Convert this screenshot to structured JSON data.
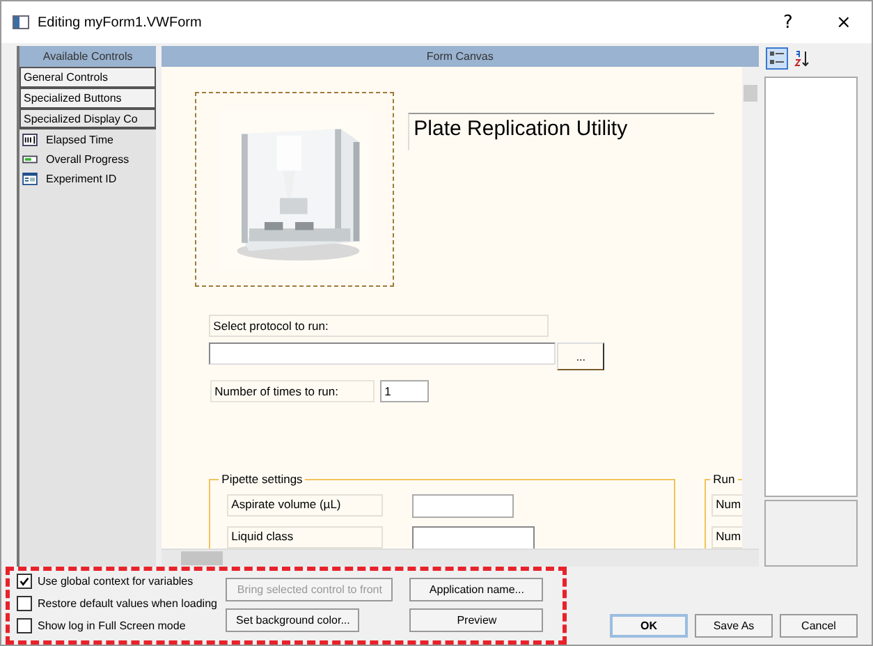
{
  "window": {
    "title": "Editing myForm1.VWForm",
    "help_button": "?",
    "close_button": "×"
  },
  "controls_panel": {
    "header": "Available Controls",
    "groups": [
      {
        "label": "General Controls",
        "expanded": false
      },
      {
        "label": "Specialized Buttons",
        "expanded": false
      },
      {
        "label": "Specialized Display Co",
        "expanded": true,
        "items": [
          {
            "label": "Elapsed Time",
            "kind": "textbox"
          },
          {
            "label": "Overall Progress",
            "kind": "progress"
          },
          {
            "label": "Experiment ID",
            "kind": "form"
          }
        ]
      }
    ]
  },
  "canvas": {
    "header": "Form Canvas",
    "title": "Plate Replication Utility",
    "protocol_label": "Select protocol to run:",
    "browse_button": "...",
    "runs_label": "Number of times to run:",
    "runs_value": "1",
    "pipette_group": {
      "legend": "Pipette settings",
      "fields": [
        {
          "label": "Aspirate volume (µL)",
          "kind": "text"
        },
        {
          "label": "Liquid class",
          "kind": "dropdown"
        }
      ]
    },
    "run_group": {
      "legend": "Run",
      "fields": [
        "Num",
        "Num"
      ]
    }
  },
  "properties_panel": {
    "views": [
      {
        "kind": "categorized",
        "selected": true
      },
      {
        "kind": "alphabetical",
        "selected": false
      }
    ]
  },
  "options": [
    {
      "label": "Use global context for variables",
      "checked": true
    },
    {
      "label": "Restore default values when loading",
      "checked": false
    },
    {
      "label": "Show log in Full Screen mode",
      "checked": false
    }
  ],
  "form_buttons": [
    {
      "label": "Bring selected control to front",
      "disabled": true
    },
    {
      "label": "Application name...",
      "disabled": false
    },
    {
      "label": "Set background color...",
      "disabled": false
    },
    {
      "label": "Preview",
      "disabled": false
    }
  ],
  "dialog_buttons": [
    {
      "label": "OK",
      "default": true
    },
    {
      "label": "Save As",
      "default": false
    },
    {
      "label": "Cancel",
      "default": false
    }
  ]
}
